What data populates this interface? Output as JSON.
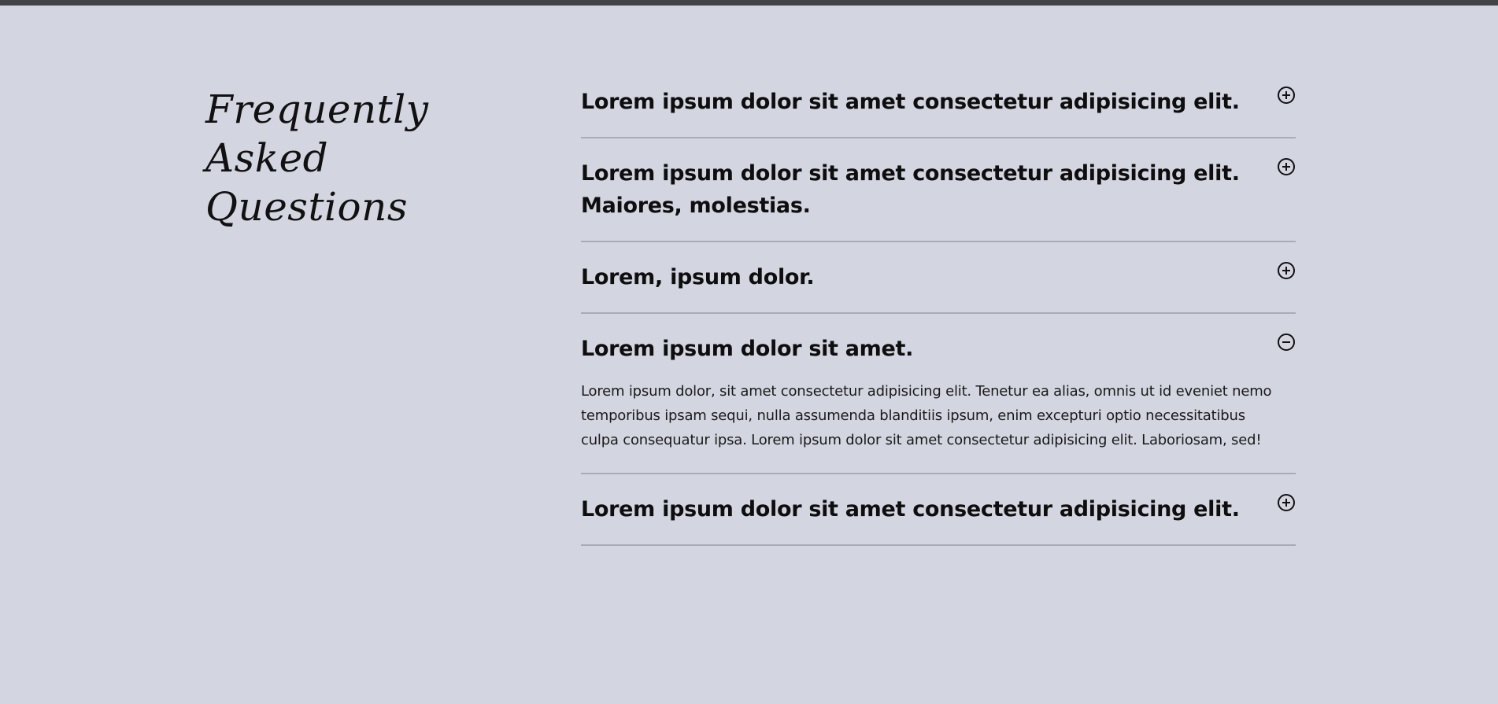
{
  "page": {
    "title": "Frequently Asked Questions"
  },
  "faq": [
    {
      "question": "Lorem ipsum dolor sit amet consectetur adipisicing elit.",
      "expanded": false,
      "icon": "plus-circle-icon"
    },
    {
      "question": "Lorem ipsum dolor sit amet consectetur adipisicing elit. Maiores, molestias.",
      "expanded": false,
      "icon": "plus-circle-icon"
    },
    {
      "question": "Lorem, ipsum dolor.",
      "expanded": false,
      "icon": "plus-circle-icon"
    },
    {
      "question": "Lorem ipsum dolor sit amet.",
      "expanded": true,
      "icon": "minus-circle-icon",
      "answer": "Lorem ipsum dolor, sit amet consectetur adipisicing elit. Tenetur ea alias, omnis ut id eveniet nemo temporibus ipsam sequi, nulla assumenda blanditiis ipsum, enim excepturi optio necessitatibus culpa consequatur ipsa. Lorem ipsum dolor sit amet consectetur adipisicing elit. Laboriosam, sed!"
    },
    {
      "question": "Lorem ipsum dolor sit amet consectetur adipisicing elit.",
      "expanded": false,
      "icon": "plus-circle-icon"
    }
  ],
  "colors": {
    "background": "#d3d5e0",
    "top_bar": "#434244",
    "divider": "#a9abb5",
    "text": "#111111"
  }
}
